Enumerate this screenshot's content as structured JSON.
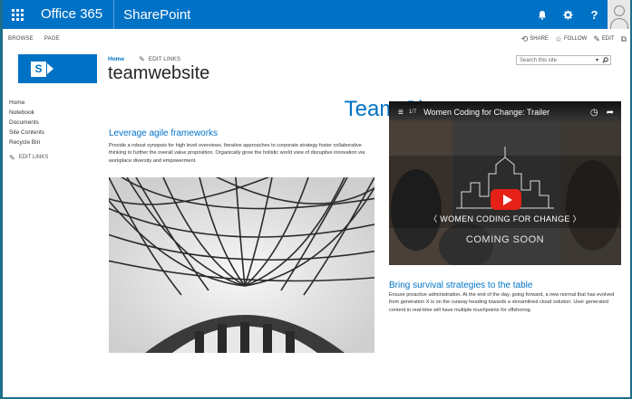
{
  "suite_bar": {
    "brand": "Office 365",
    "app": "SharePoint",
    "icons": [
      "waffle-icon",
      "bell-icon",
      "gear-icon",
      "help-icon",
      "user-avatar"
    ]
  },
  "ribbon": {
    "tabs": [
      "BROWSE",
      "PAGE"
    ],
    "share": "SHARE",
    "follow": "FOLLOW",
    "edit": "EDIT"
  },
  "site": {
    "home": "Home",
    "edit_links": "EDIT LINKS",
    "title": "teamwebsite",
    "search_placeholder": "Search this site"
  },
  "left_nav": {
    "items": [
      "Home",
      "Notebook",
      "Documents",
      "Site Contents",
      "Recycle Bin"
    ],
    "edit_links": "EDIT LINKS"
  },
  "main": {
    "heading": "Team Site",
    "section1": {
      "title": "Leverage agile frameworks",
      "body": "Provide a robust synopsis for high level overviews. Iterative approaches to corporate strategy foster collaborative thinking to further the overall value proposition. Organically grow the holistic world view of disruptive innovation via workplace diversity and empowerment."
    },
    "video": {
      "count": "1/7",
      "title": "Women Coding for Change: Trailer",
      "brand": "WOMEN CODING FOR CHANGE",
      "coming_soon": "COMING SOON"
    },
    "section2": {
      "title": "Bring survival strategies to the table",
      "body": "Ensure proactive administration. At the end of the day, going forward, a new normal that has evolved from generation X is on the runway heading towards a streamlined cloud solution. User generated content in real-time will have multiple touchpoints for offshoring."
    }
  },
  "colors": {
    "suite_bar": "#0072c6",
    "accent": "#0072c6",
    "frame": "#1f6f8b"
  }
}
